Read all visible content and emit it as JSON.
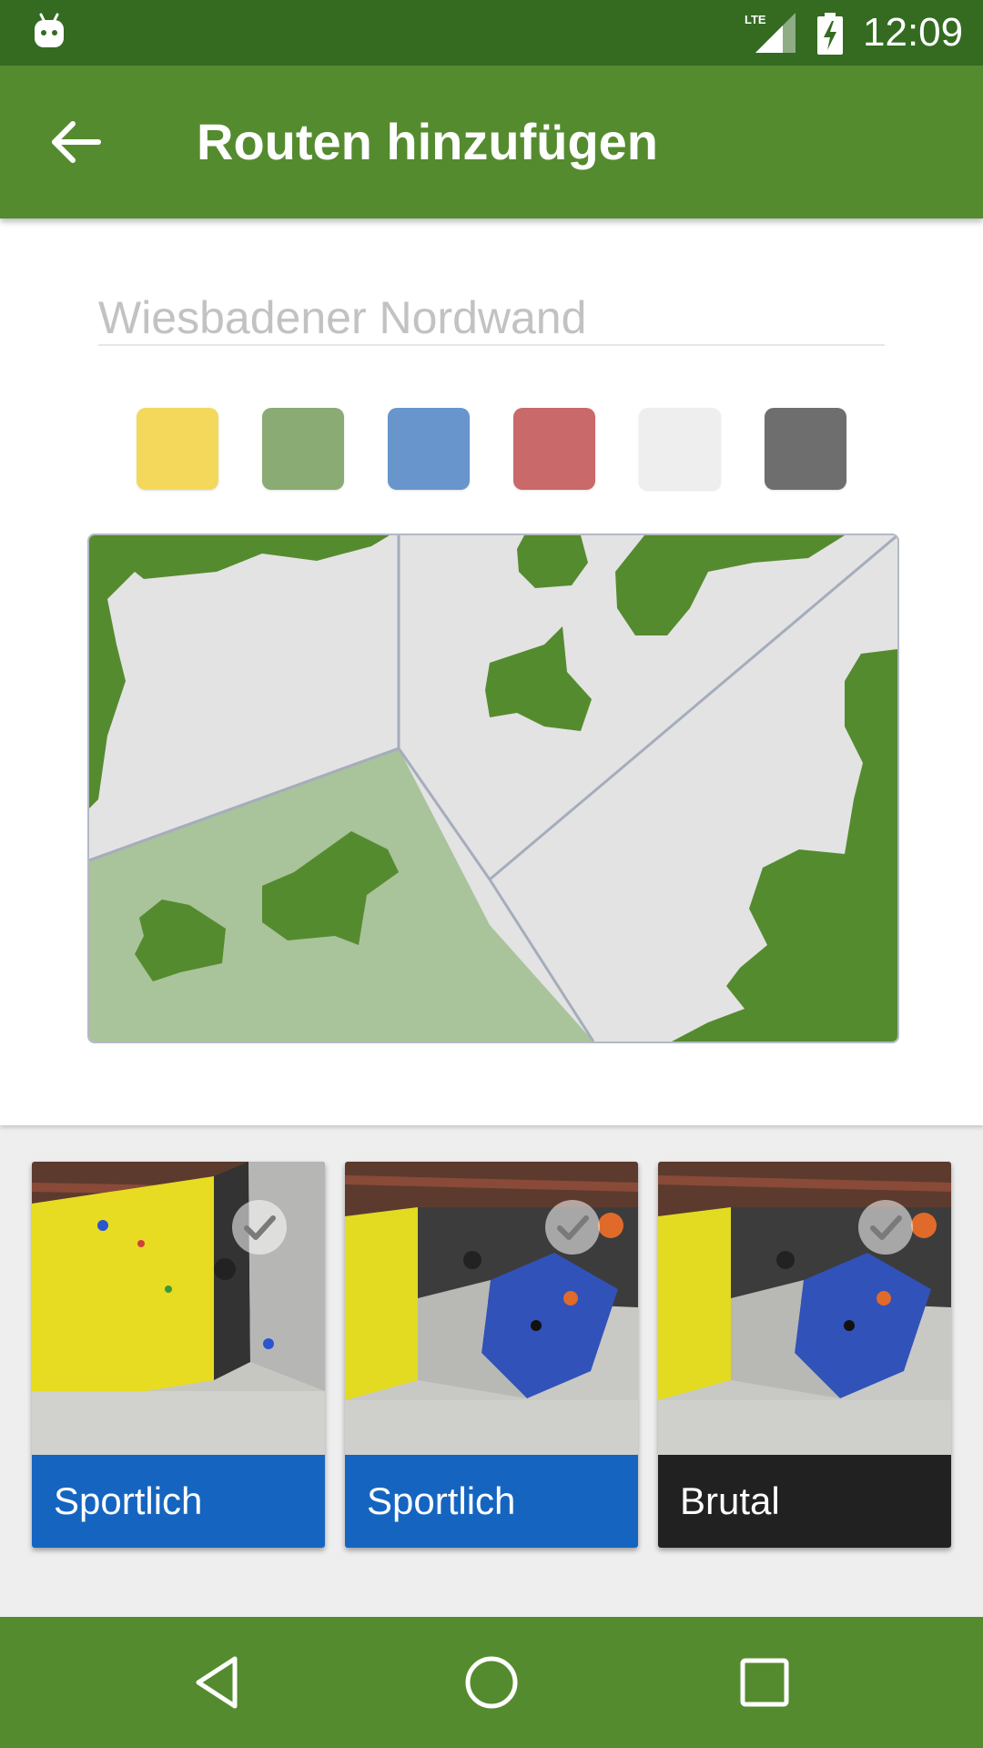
{
  "status_bar": {
    "time": "12:09",
    "network": "LTE",
    "icons": [
      "android-icon",
      "lte-signal-icon",
      "battery-charging-icon"
    ]
  },
  "app_bar": {
    "title": "Routen hinzufügen",
    "back_icon": "arrow-back-icon"
  },
  "form": {
    "name_value": "",
    "name_placeholder": "Wiesbadener Nordwand"
  },
  "colors": [
    {
      "name": "yellow",
      "hex": "#f3d85c"
    },
    {
      "name": "green",
      "hex": "#8aab73"
    },
    {
      "name": "blue",
      "hex": "#6895cc"
    },
    {
      "name": "red",
      "hex": "#c96969"
    },
    {
      "name": "white",
      "hex": "#eeeeee"
    },
    {
      "name": "black",
      "hex": "#6e6e6e"
    }
  ],
  "wall_map": {
    "fill": "#e3e3e3",
    "hold_color": "#558b2f",
    "selected_color": "#a9c39b",
    "line_color": "#a5adbc"
  },
  "route_cards": [
    {
      "label": "Sportlich",
      "color": "#1565c0",
      "photo": "yellow-wall-photo"
    },
    {
      "label": "Sportlich",
      "color": "#1565c0",
      "photo": "blue-volume-photo"
    },
    {
      "label": "Brutal",
      "color": "#212121",
      "photo": "blue-volume-photo"
    }
  ],
  "nav_bar": {
    "icons": [
      "back-triangle-icon",
      "home-circle-icon",
      "recents-square-icon"
    ]
  },
  "theme": {
    "primary": "#558b2f",
    "primary_dark": "#346b21"
  }
}
